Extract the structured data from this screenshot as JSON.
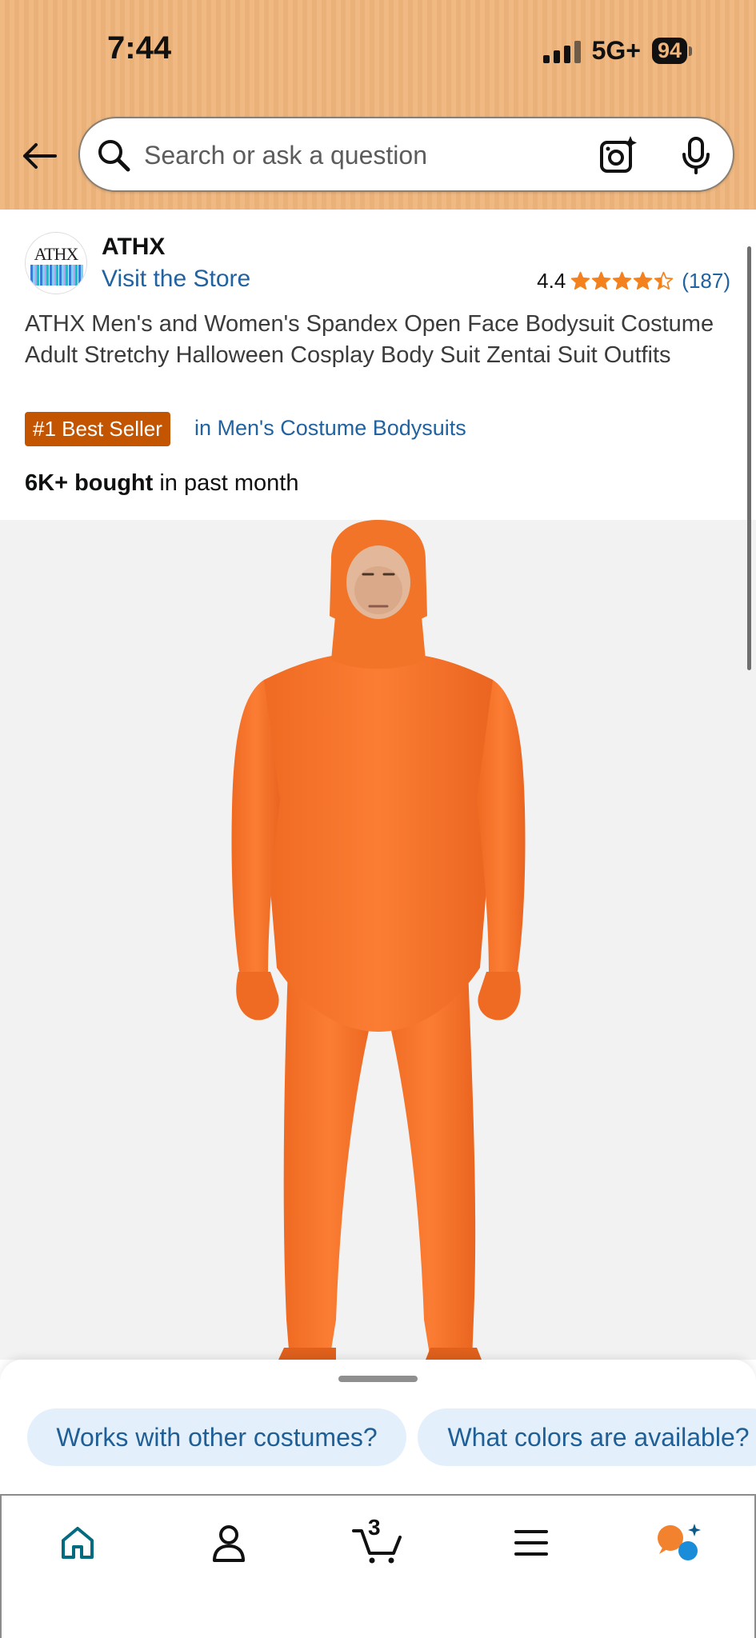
{
  "status_bar": {
    "time": "7:44",
    "network": "5G+",
    "battery": "94"
  },
  "search": {
    "placeholder": "Search or ask a question"
  },
  "brand": {
    "logo_text": "ATHX",
    "name": "ATHX",
    "store_link": "Visit the Store",
    "rating": "4.4",
    "stars": 4.4,
    "review_count": "(187)"
  },
  "product": {
    "title": "ATHX Men's and Women's Spandex Open Face Bodysuit Costume Adult Stretchy Halloween Cosplay Body Suit Zentai Suit Outfits",
    "badge": "#1 Best Seller",
    "badge_category": "in Men's Costume Bodysuits",
    "bought_bold": "6K+ bought",
    "bought_rest": " in past month"
  },
  "suggestions": [
    {
      "label": "Works with other costumes?"
    },
    {
      "label": "What colors are available?"
    }
  ],
  "nav": {
    "cart_count": "3"
  },
  "colors": {
    "header": "#efb57c",
    "link": "#2162a1",
    "badge": "#c45500",
    "star": "#f3821e",
    "suit": "#f7742a"
  },
  "icons": [
    "back-arrow-icon",
    "search-icon",
    "camera-lens-icon",
    "microphone-icon",
    "home-icon",
    "account-icon",
    "cart-icon",
    "menu-icon",
    "rufus-chat-icon"
  ]
}
